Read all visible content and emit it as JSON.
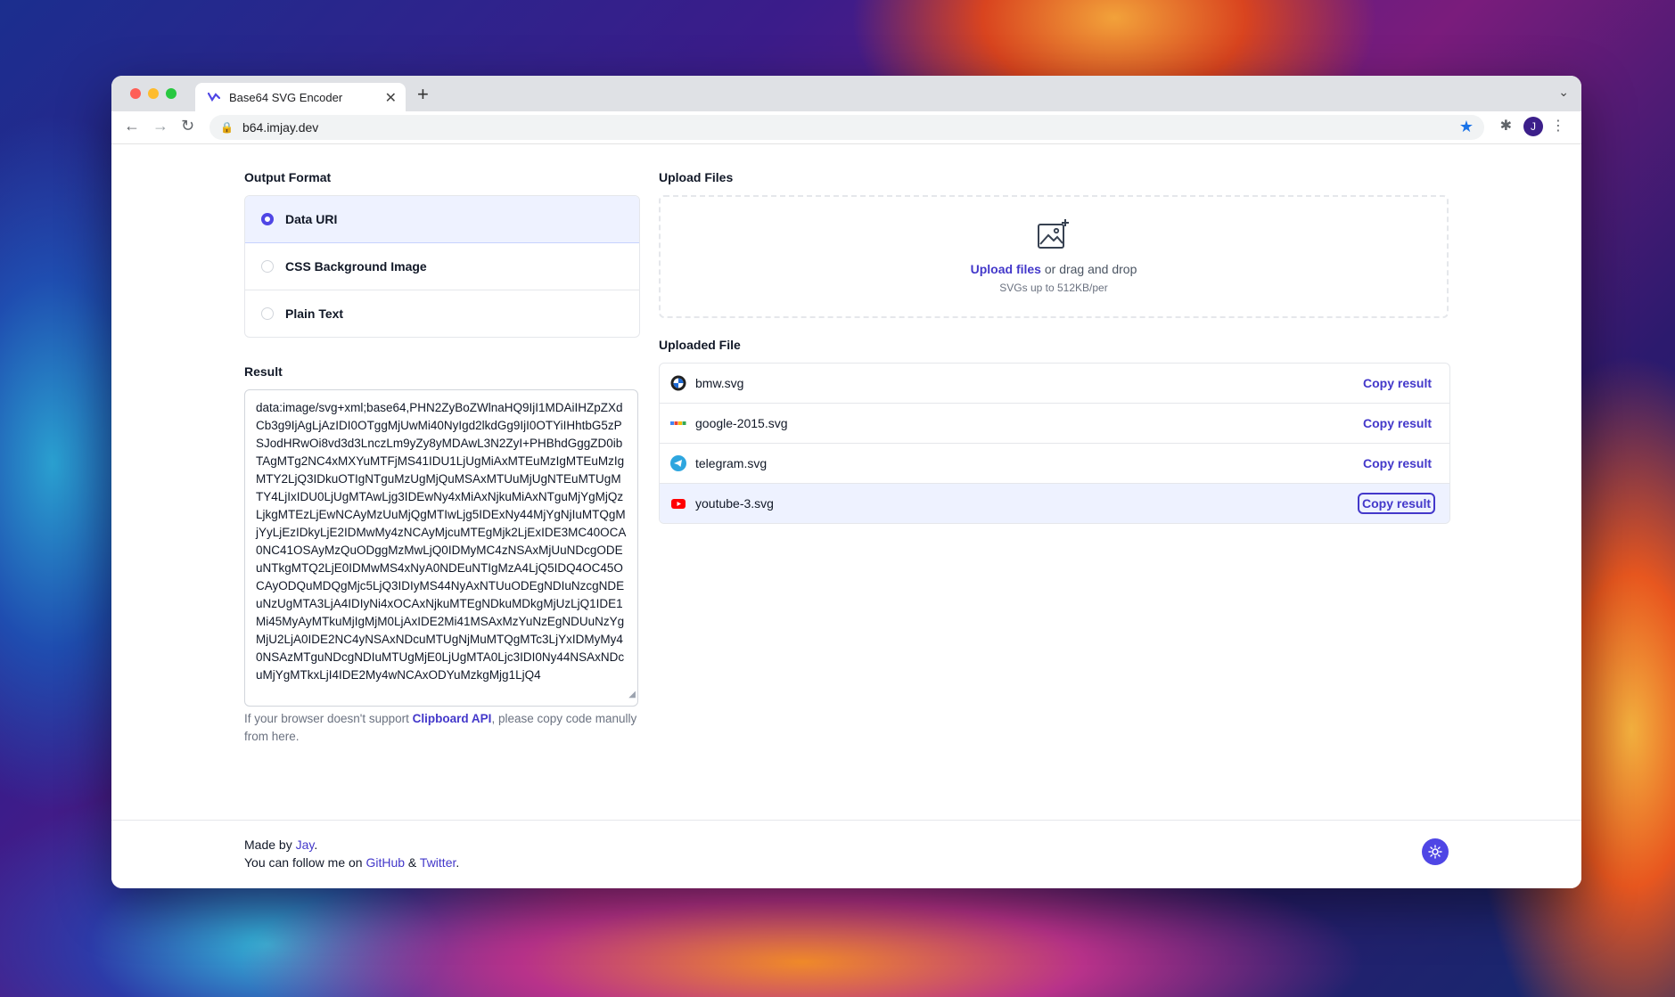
{
  "browser": {
    "tab_title": "Base64 SVG Encoder",
    "url": "b64.imjay.dev",
    "profile_initial": "J",
    "new_tab_symbol": "+",
    "close_symbol": "✕"
  },
  "output_format": {
    "label": "Output Format",
    "options": [
      {
        "label": "Data URI",
        "selected": true
      },
      {
        "label": "CSS Background Image",
        "selected": false
      },
      {
        "label": "Plain Text",
        "selected": false
      }
    ]
  },
  "result": {
    "label": "Result",
    "text": "data:image/svg+xml;base64,PHN2ZyBoZWlnaHQ9IjI1MDAiIHZpZXdCb3g9IjAgLjAzIDI0OTggMjUwMi40NyIgd2lkdGg9IjI0OTYiIHhtbG5zPSJodHRwOi8vd3d3LnczLm9yZy8yMDAwL3N2ZyI+PHBhdGggZD0ibTAgMTg2NC4xMXYuMTFjMS41IDU1LjUgMiAxMTEuMzIgMTEuMzIgMTY2LjQ3IDkuOTIgNTguMzUgMjQuMSAxMTUuMjUgNTEuMTUgMTY4LjIxIDU0LjUgMTAwLjg3IDEwNy4xMiAxNjkuMiAxNTguMjYgMjQzLjkgMTEzLjEwNCAyMzUuMjQgMTIwLjg5IDExNy44MjYgNjIuMTQgMjYyLjEzIDkyLjE2IDMwMy4zNCAyMjcuMTEgMjk2LjExIDE3MC40OCA0NC41OSAyMzQuODggMzMwLjQ0IDMyMC4zNSAxMjUuNDcgODEuNTkgMTQ2LjE0IDMwMS4xNyA0NDEuNTIgMzA4LjQ5IDQ4OC45OCAyODQuMDQgMjc5LjQ3IDIyMS44NyAxNTUuODEgNDIuNzcgNDEuNzUgMTA3LjA4IDIyNi4xOCAxNjkuMTEgNDkuMDkgMjUzLjQ1IDE1Mi45MyAyMTkuMjIgMjM0LjAxIDE2Mi41MSAxMzYuNzEgNDUuNzYgMjU2LjA0IDE2NC4yNSAxNDcuMTUgNjMuMTQgMTc3LjYxIDMyMy40NSAzMTguNDcgNDIuMTUgMjE0LjUgMTA0Ljc3IDI0Ny44NSAxNDcuMjYgMTkxLjI4IDE2My4wNCAxODYuMzkgMjg1LjQ4"
  },
  "hint": {
    "before": "If your browser doesn't support ",
    "link": "Clipboard API",
    "after": ", please copy code manully from here."
  },
  "upload": {
    "label": "Upload Files",
    "link": "Upload files",
    "text": " or drag and drop",
    "sub": "SVGs up to 512KB/per"
  },
  "uploaded": {
    "label": "Uploaded File",
    "copy_label": "Copy result",
    "files": [
      {
        "name": "bmw.svg",
        "icon": "bmw-icon"
      },
      {
        "name": "google-2015.svg",
        "icon": "google-icon"
      },
      {
        "name": "telegram.svg",
        "icon": "telegram-icon"
      },
      {
        "name": "youtube-3.svg",
        "icon": "youtube-icon"
      }
    ]
  },
  "footer": {
    "made_by": "Made by ",
    "author": "Jay",
    "period": ".",
    "follow": "You can follow me on ",
    "github": "GitHub",
    "amp": " & ",
    "twitter": "Twitter",
    "end": "."
  },
  "colors": {
    "accent": "#4f46e5",
    "link": "#4338ca"
  }
}
